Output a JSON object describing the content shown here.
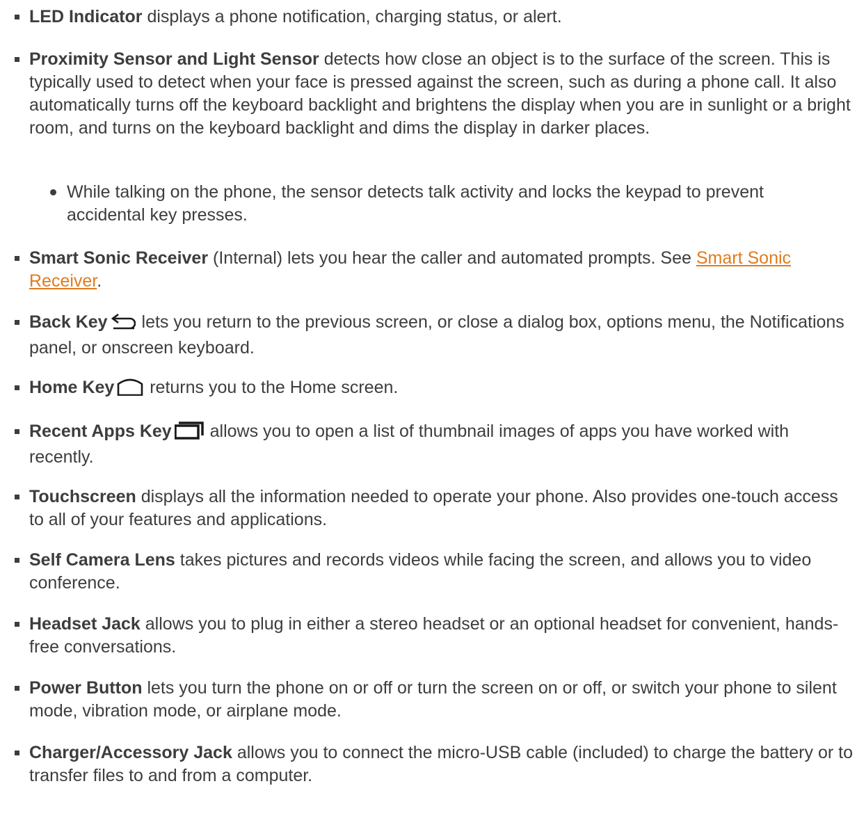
{
  "items": [
    {
      "term": "LED Indicator",
      "desc": "displays a phone notification, charging status, or alert."
    },
    {
      "term": "Proximity Sensor and Light Sensor",
      "desc": "detects how close an object is to the surface of the screen. This is typically used to detect when your face is pressed against the screen, such as during a phone call. It also automatically turns off the keyboard backlight and brightens the display when you are in sunlight or a bright room, and turns on the keyboard backlight and dims the display in darker places."
    },
    {
      "sub": "While talking on the phone, the sensor detects talk activity and locks the keypad to prevent accidental key presses."
    },
    {
      "term": "Smart Sonic Receiver",
      "desc_before": "(Internal) lets you hear the caller and automated prompts. See",
      "link": "Smart Sonic Receiver",
      "desc_after": "."
    },
    {
      "term": "Back Key",
      "icon": "back-arrow-icon",
      "desc": "lets you return to the previous screen, or close a dialog box, options menu, the Notifications panel, or onscreen keyboard."
    },
    {
      "term": "Home Key",
      "icon": "home-outline-icon",
      "desc": "returns you to the Home screen."
    },
    {
      "term": "Recent Apps Key",
      "icon": "recent-apps-icon",
      "desc": "allows you to open a list of thumbnail images of apps you have worked with recently."
    },
    {
      "term": "Touchscreen",
      "desc": "displays all the information needed to operate your phone. Also provides one-touch access to all of your features and applications."
    },
    {
      "term": "Self Camera Lens",
      "desc": "takes pictures and records videos while facing the screen, and allows you to video conference."
    },
    {
      "term": "Headset Jack",
      "desc": "allows you to plug in either a stereo headset or an optional headset for convenient, hands-free conversations."
    },
    {
      "term": "Power Button",
      "desc": "lets you turn the phone on or off or turn the screen on or off, or switch your phone to silent mode, vibration mode, or airplane mode."
    },
    {
      "term": "Charger/Accessory Jack",
      "desc": "allows you to connect the micro-USB cable (included) to charge the battery or to transfer files to and from a computer."
    }
  ],
  "colors": {
    "text": "#3d3d3d",
    "link": "#e07b1f"
  }
}
